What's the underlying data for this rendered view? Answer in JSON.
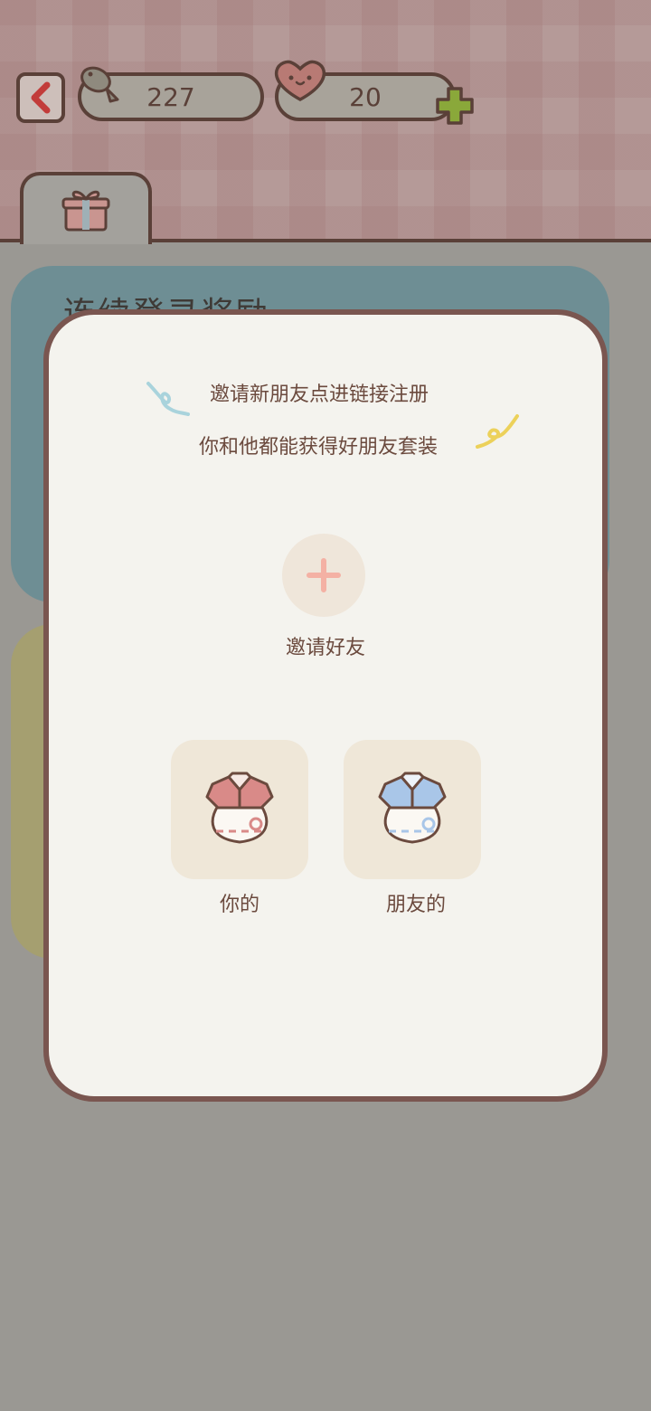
{
  "header": {
    "fish_count": "227",
    "heart_count": "20"
  },
  "background": {
    "card_title": "连续登录奖励"
  },
  "modal": {
    "message_line1": "邀请新朋友点进链接注册",
    "message_line2": "你和他都能获得好朋友套装",
    "invite_label": "邀请好友",
    "reward_mine_label": "你的",
    "reward_friend_label": "朋友的"
  },
  "colors": {
    "outline": "#5a4038",
    "modal_bg": "#f4f3ee",
    "modal_border": "#7a5650",
    "accent_pink": "#f4b1a4",
    "outfit_pink": "#d98a88",
    "outfit_blue": "#a9c6e8",
    "plus_green": "#8aa83a"
  },
  "icons": [
    "back-arrow-icon",
    "fish-icon",
    "heart-face-icon",
    "plus-icon",
    "gift-icon",
    "invite-plus-icon",
    "outfit-pink-icon",
    "outfit-blue-icon"
  ]
}
